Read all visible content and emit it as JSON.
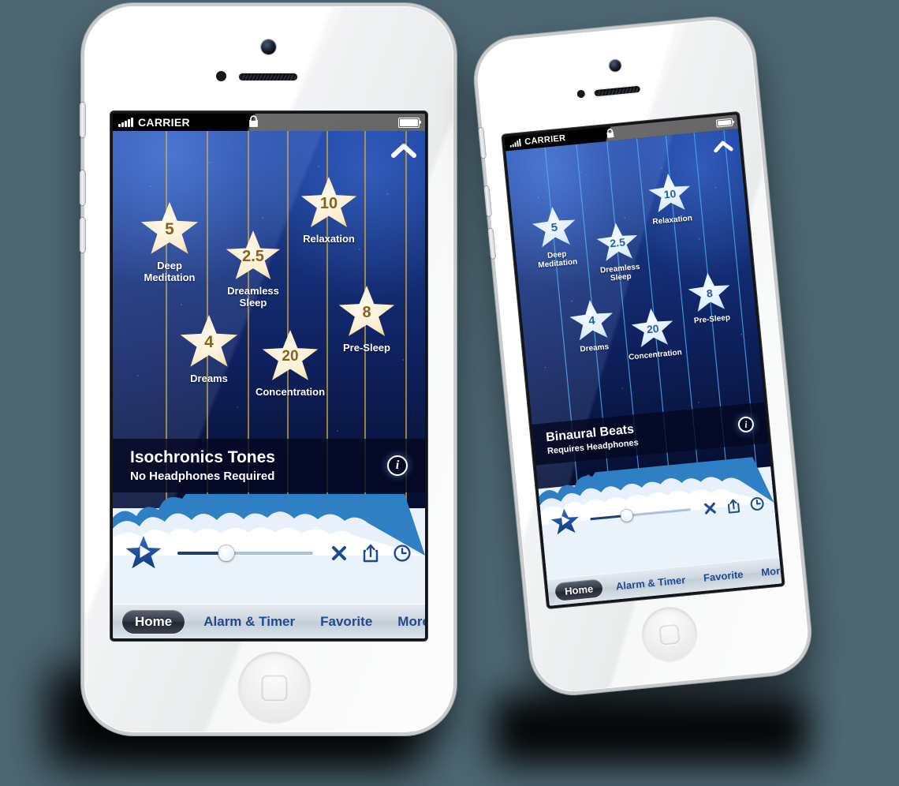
{
  "background_color": "#4d6773",
  "phones": [
    {
      "id": "phone-a",
      "device_color": "white",
      "status_bar": {
        "carrier": "CARRIER",
        "lock_icon": "lock-icon",
        "battery_icon": "battery-icon"
      },
      "screen": {
        "collapse_icon": "chevron-up-icon",
        "stars": [
          {
            "value": "5",
            "label": "Deep Meditation"
          },
          {
            "value": "2.5",
            "label": "Dreamless Sleep"
          },
          {
            "value": "10",
            "label": "Relaxation"
          },
          {
            "value": "4",
            "label": "Dreams"
          },
          {
            "value": "20",
            "label": "Concentration"
          },
          {
            "value": "8",
            "label": "Pre-Sleep"
          }
        ],
        "banner": {
          "title": "Isochronics Tones",
          "subtitle": "No Headphones Required",
          "info_icon": "info-icon"
        },
        "page_dots": {
          "count": 11,
          "active_index": 0
        },
        "controls": {
          "play_icon": "star-play-icon",
          "slider_value_percent": 36,
          "close_icon": "close-x-icon",
          "share_icon": "share-icon",
          "timer_icon": "clock-icon"
        },
        "tabs": [
          {
            "label": "Home",
            "selected": true
          },
          {
            "label": "Alarm & Timer",
            "selected": false
          },
          {
            "label": "Favorite",
            "selected": false
          },
          {
            "label": "More",
            "selected": false
          }
        ]
      }
    },
    {
      "id": "phone-b",
      "device_color": "white",
      "status_bar": {
        "carrier": "CARRIER",
        "lock_icon": "lock-icon",
        "battery_icon": "battery-icon"
      },
      "screen": {
        "collapse_icon": "chevron-up-icon",
        "stars": [
          {
            "value": "5",
            "label": "Deep Meditation"
          },
          {
            "value": "2.5",
            "label": "Dreamless Sleep"
          },
          {
            "value": "10",
            "label": "Relaxation"
          },
          {
            "value": "4",
            "label": "Dreams"
          },
          {
            "value": "20",
            "label": "Concentration"
          },
          {
            "value": "8",
            "label": "Pre-Sleep"
          }
        ],
        "banner": {
          "title": "Binaural Beats",
          "subtitle": "Requires Headphones",
          "info_icon": "info-icon"
        },
        "page_dots": {
          "count": 11,
          "active_index": 1
        },
        "controls": {
          "play_icon": "star-play-icon",
          "slider_value_percent": 36,
          "close_icon": "close-x-icon",
          "share_icon": "share-icon",
          "timer_icon": "clock-icon"
        },
        "tabs": [
          {
            "label": "Home",
            "selected": true
          },
          {
            "label": "Alarm & Timer",
            "selected": false
          },
          {
            "label": "Favorite",
            "selected": false
          },
          {
            "label": "More",
            "selected": false
          }
        ]
      }
    }
  ],
  "colors": {
    "star_gold_face": "#fdf0d2",
    "star_gold_edge": "#e0a520",
    "star_blue_face": "#dff0fb",
    "star_blue_edge": "#2f86d8",
    "accent_blue": "#1d4a93",
    "sky_top": "#1a3fa0",
    "sky_bottom": "#060d2c"
  }
}
